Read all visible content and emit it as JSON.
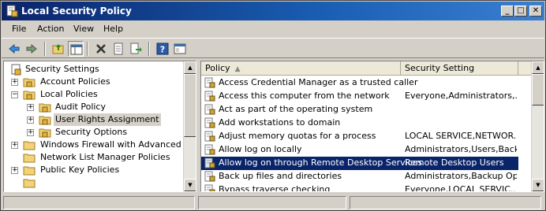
{
  "window": {
    "title": "Local Security Policy",
    "controls": {
      "minimize": "_",
      "maximize": "□",
      "close": "✕"
    }
  },
  "menu": [
    "File",
    "Action",
    "View",
    "Help"
  ],
  "toolbar": {
    "icons": [
      "back-arrow-icon",
      "forward-arrow-icon",
      "up-folder-icon",
      "show-hide-tree-icon",
      "delete-icon",
      "properties-icon",
      "export-list-icon",
      "help-icon",
      "console-icon"
    ]
  },
  "tree": {
    "root": "Security Settings",
    "items": [
      {
        "label": "Account Policies",
        "level": 1,
        "expander": "+"
      },
      {
        "label": "Local Policies",
        "level": 1,
        "expander": "−"
      },
      {
        "label": "Audit Policy",
        "level": 2,
        "expander": "+"
      },
      {
        "label": "User Rights Assignment",
        "level": 2,
        "expander": "+",
        "selected": true
      },
      {
        "label": "Security Options",
        "level": 2,
        "expander": "+"
      },
      {
        "label": "Windows Firewall with Advanced Secu",
        "level": 1,
        "expander": "+"
      },
      {
        "label": "Network List Manager Policies",
        "level": 1,
        "expander": ""
      },
      {
        "label": "Public Key Policies",
        "level": 1,
        "expander": "+"
      }
    ]
  },
  "list": {
    "columns": {
      "policy": "Policy",
      "setting": "Security Setting"
    },
    "rows": [
      {
        "policy": "Access Credential Manager as a trusted caller",
        "setting": ""
      },
      {
        "policy": "Access this computer from the network",
        "setting": "Everyone,Administrators,..."
      },
      {
        "policy": "Act as part of the operating system",
        "setting": ""
      },
      {
        "policy": "Add workstations to domain",
        "setting": ""
      },
      {
        "policy": "Adjust memory quotas for a process",
        "setting": "LOCAL SERVICE,NETWOR..."
      },
      {
        "policy": "Allow log on locally",
        "setting": "Administrators,Users,Back..."
      },
      {
        "policy": "Allow log on through Remote Desktop Services",
        "setting": "Remote Desktop Users",
        "selected": true
      },
      {
        "policy": "Back up files and directories",
        "setting": "Administrators,Backup Op..."
      },
      {
        "policy": "Bypass traverse checking",
        "setting": "Everyone,LOCAL SERVIC..."
      }
    ]
  },
  "colors": {
    "selection": "#0a246a",
    "titlebar": "#0a246a"
  }
}
